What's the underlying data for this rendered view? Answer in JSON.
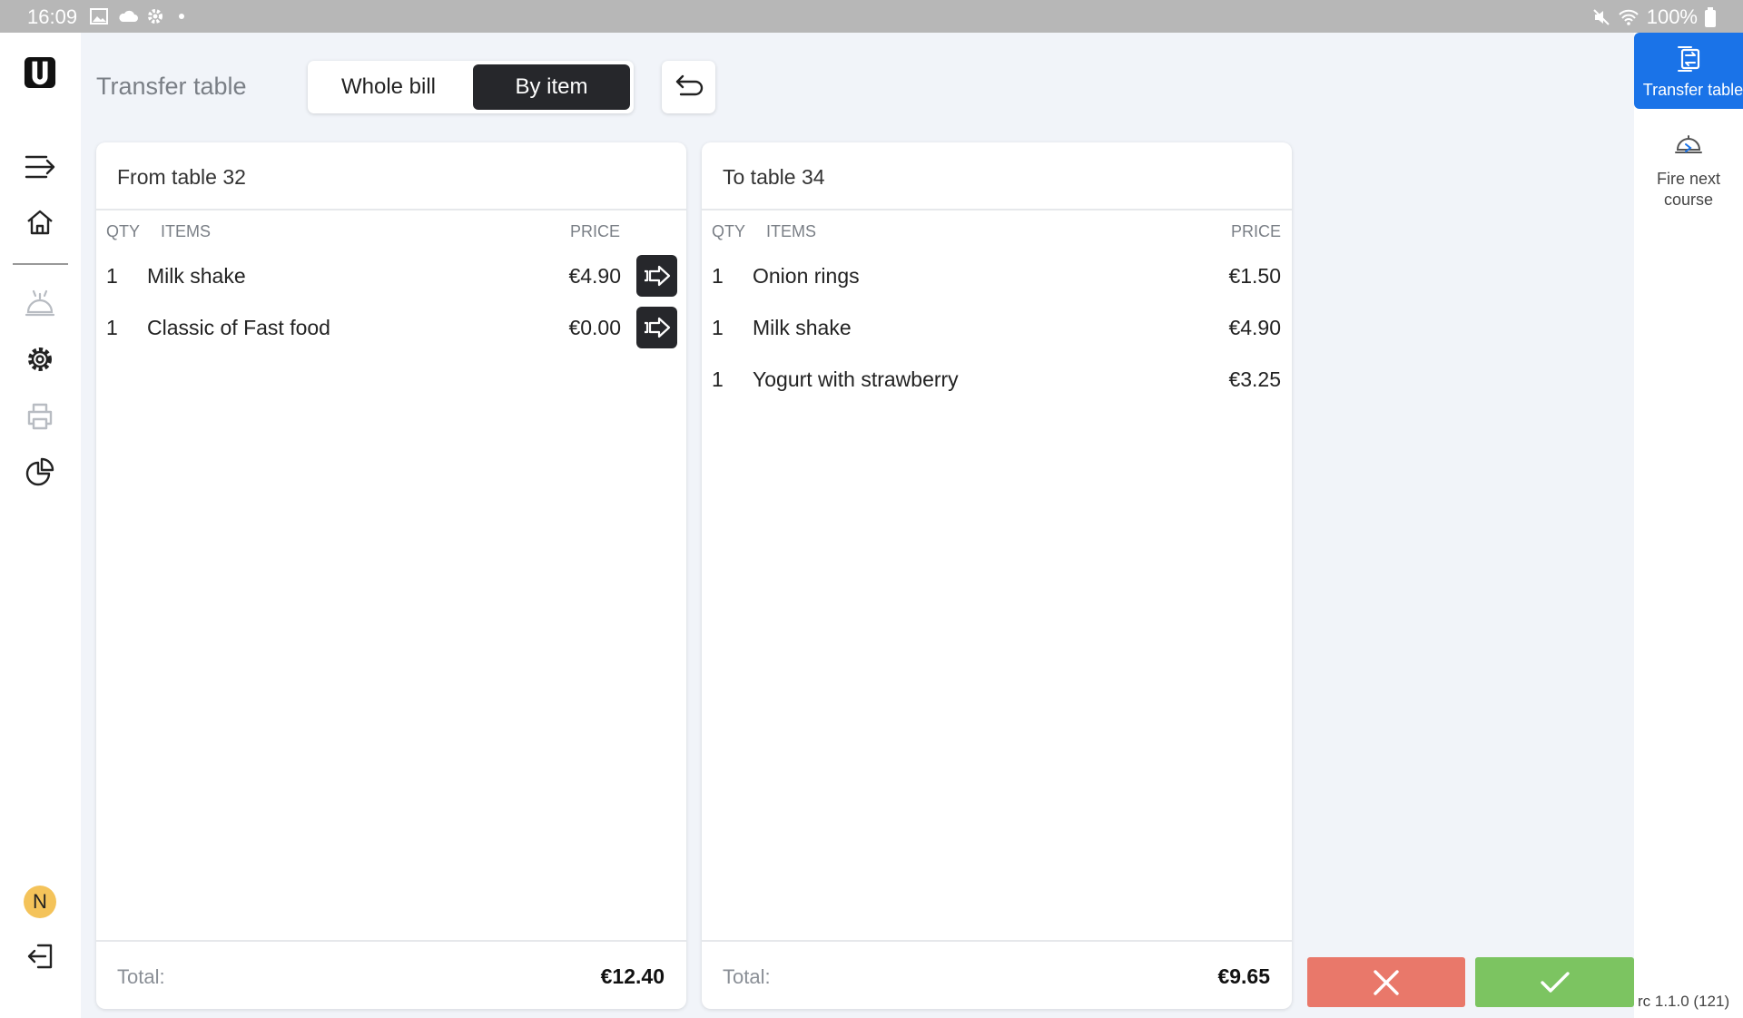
{
  "status_bar": {
    "time": "16:09",
    "battery": "100%"
  },
  "header": {
    "title": "Transfer table",
    "mode_options": [
      "Whole bill",
      "By item"
    ],
    "active_mode": "By item"
  },
  "from_panel": {
    "title": "From table 32",
    "columns": {
      "qty": "QTY",
      "items": "ITEMS",
      "price": "PRICE"
    },
    "rows": [
      {
        "qty": "1",
        "name": "Milk shake",
        "price": "€4.90"
      },
      {
        "qty": "1",
        "name": "Classic of Fast food",
        "price": "€0.00"
      }
    ],
    "total_label": "Total:",
    "total_value": "€12.40"
  },
  "to_panel": {
    "title": "To table 34",
    "columns": {
      "qty": "QTY",
      "items": "ITEMS",
      "price": "PRICE"
    },
    "rows": [
      {
        "qty": "1",
        "name": "Onion rings",
        "price": "€1.50"
      },
      {
        "qty": "1",
        "name": "Milk shake",
        "price": "€4.90"
      },
      {
        "qty": "1",
        "name": "Yogurt with strawberry",
        "price": "€3.25"
      }
    ],
    "total_label": "Total:",
    "total_value": "€9.65"
  },
  "right_rail": {
    "transfer_label": "Transfer table",
    "fire_label_1": "Fire next",
    "fire_label_2": "course"
  },
  "user": {
    "initial": "N"
  },
  "version": "rc 1.1.0 (121)",
  "colors": {
    "accent": "#1a73e8",
    "dark": "#26272b",
    "cancel": "#e9786a",
    "confirm": "#7cc461",
    "avatar": "#f4c35a"
  }
}
